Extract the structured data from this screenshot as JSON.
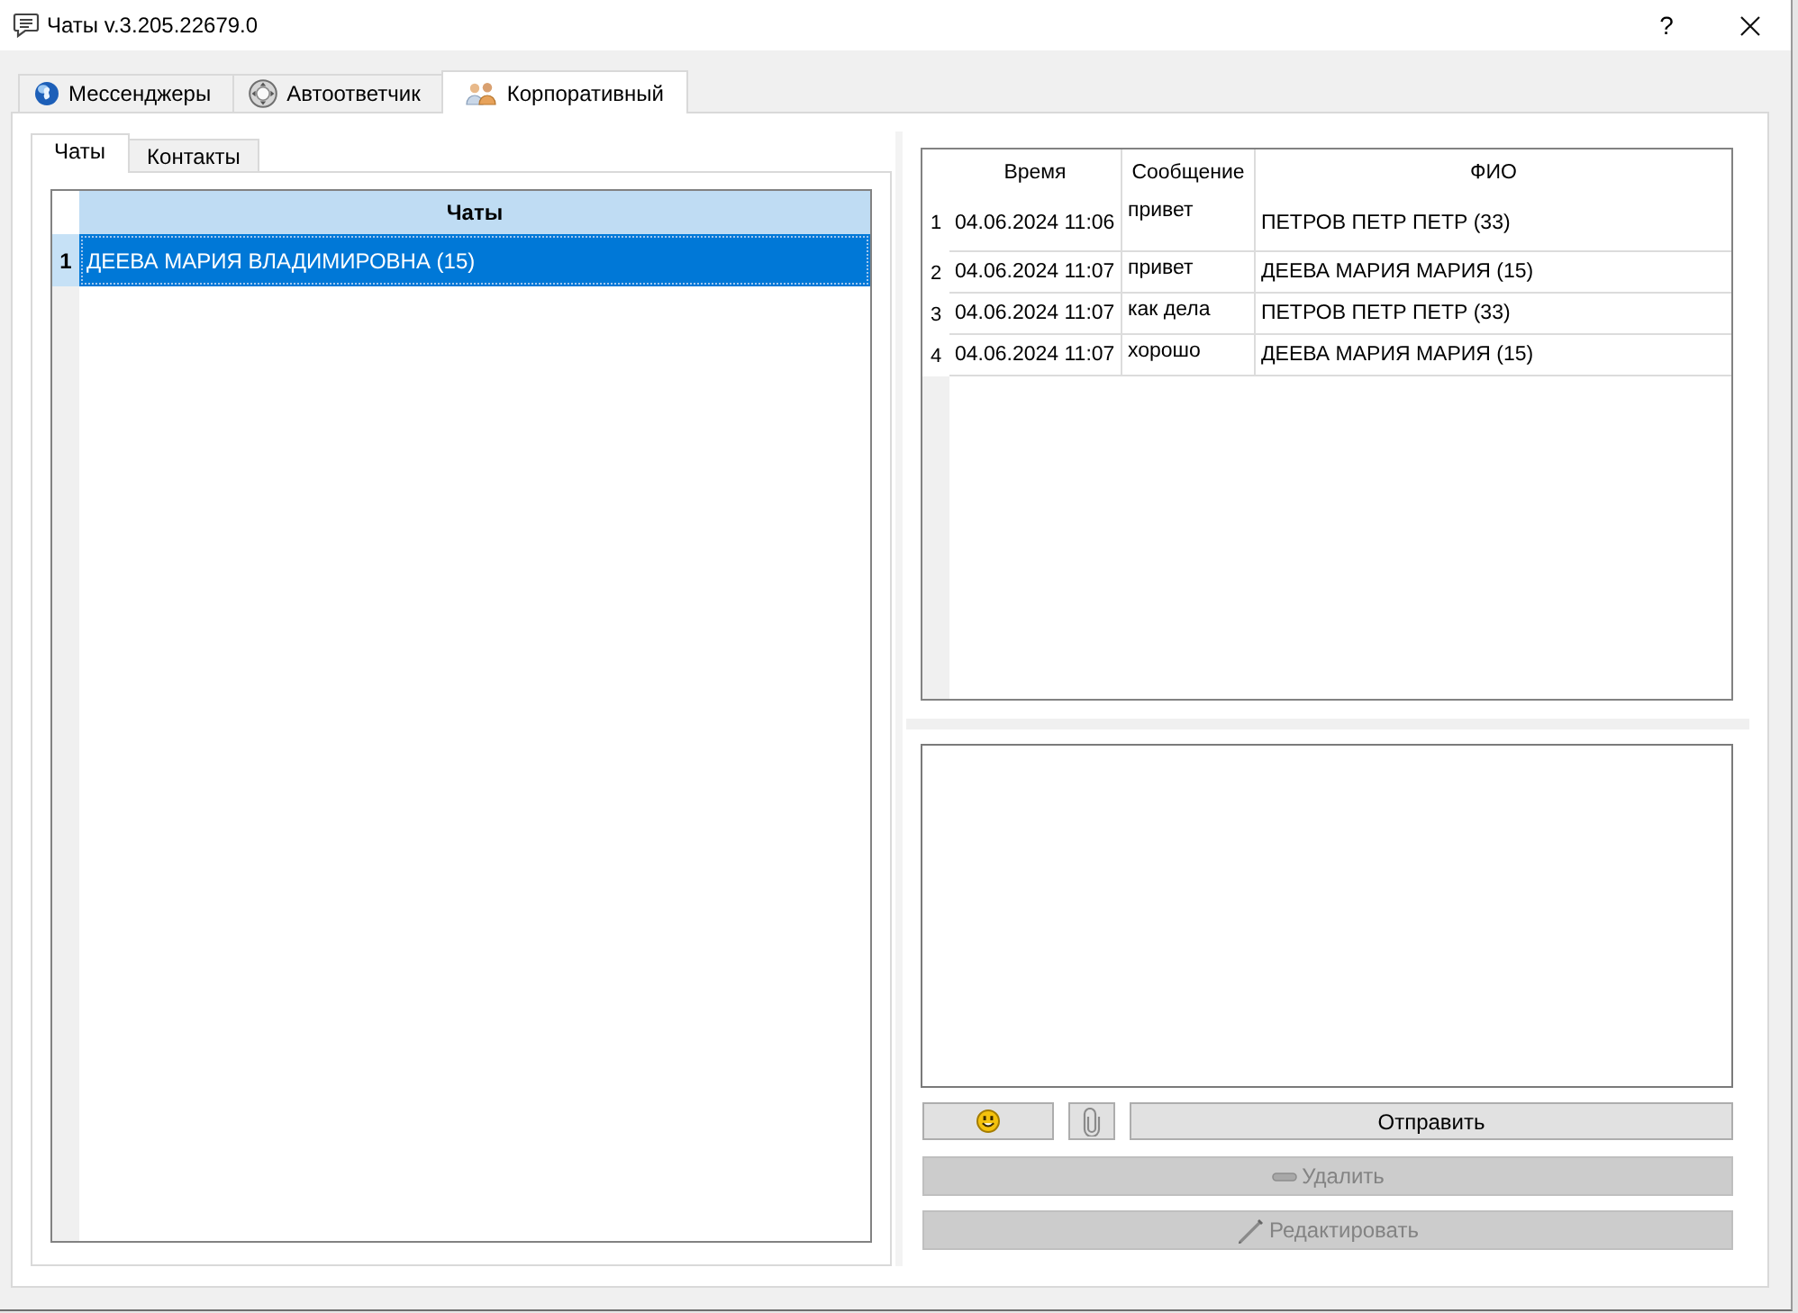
{
  "window": {
    "title": "Чаты v.3.205.22679.0",
    "help": "?"
  },
  "tabs": [
    {
      "kind": "messengers",
      "label": "Мессенджеры",
      "selected": false
    },
    {
      "kind": "autoresponder",
      "label": "Автоответчик",
      "selected": false
    },
    {
      "kind": "corporate",
      "label": "Корпоративный",
      "selected": true
    }
  ],
  "subtabs": [
    {
      "label": "Чаты",
      "selected": true
    },
    {
      "label": "Контакты",
      "selected": false
    }
  ],
  "chats_table": {
    "columns": [
      "Чаты"
    ],
    "rows": [
      {
        "number": "1",
        "name": "ДЕЕВА МАРИЯ ВЛАДИМИРОВНА (15)",
        "selected": true
      }
    ]
  },
  "messages_table": {
    "columns": [
      "Время",
      "Сообщение",
      "ФИО"
    ],
    "rows": [
      {
        "number": "1",
        "time": "04.06.2024 11:06",
        "message": "привет",
        "name": "ПЕТРОВ ПЕТР ПЕТР (33)"
      },
      {
        "number": "2",
        "time": "04.06.2024 11:07",
        "message": "привет",
        "name": "ДЕЕВА МАРИЯ МАРИЯ (15)"
      },
      {
        "number": "3",
        "time": "04.06.2024 11:07",
        "message": "как дела",
        "name": "ПЕТРОВ ПЕТР ПЕТР (33)"
      },
      {
        "number": "4",
        "time": "04.06.2024 11:07",
        "message": "хорошо",
        "name": "ДЕЕВА МАРИЯ МАРИЯ (15)"
      }
    ]
  },
  "compose_buttons": [
    {
      "kind": "emoji",
      "disabled": false
    },
    {
      "kind": "attach",
      "disabled": false
    },
    {
      "kind": "send",
      "label": "Отправить",
      "disabled": false
    }
  ],
  "actions": [
    {
      "kind": "delete",
      "label": "Удалить",
      "disabled": true
    },
    {
      "kind": "edit",
      "label": "Редактировать",
      "disabled": true
    }
  ]
}
